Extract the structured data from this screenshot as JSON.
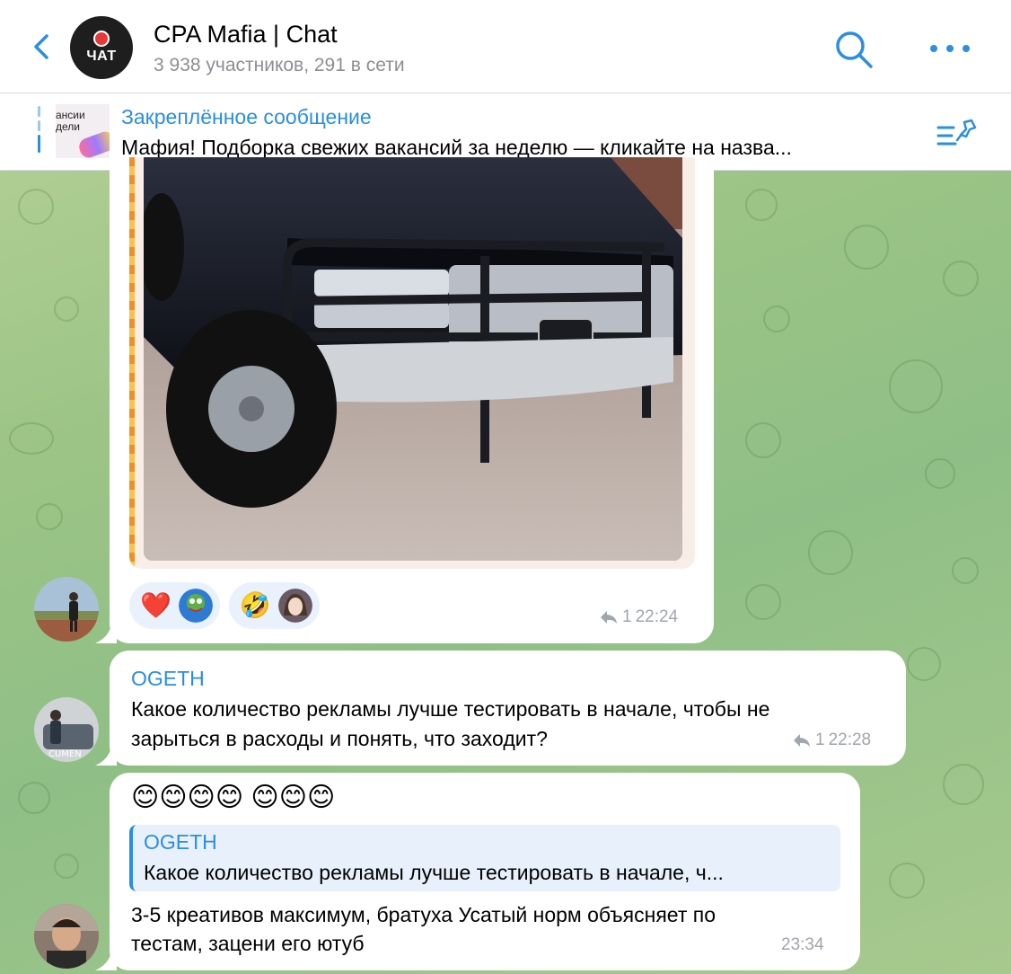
{
  "header": {
    "title": "CPA Mafia | Chat",
    "subtitle": "3 938 участников, 291 в сети",
    "avatar_text": "ЧАТ"
  },
  "pinned": {
    "label": "Закреплённое сообщение",
    "text": "Мафия! Подборка свежих вакансий за неделю — кликайте на назва...",
    "thumb_text": "ансии\nдели"
  },
  "messages": [
    {
      "type": "photo",
      "reactions": [
        {
          "emoji": "❤️"
        },
        {
          "emoji": "🤣"
        }
      ],
      "forwards": "1",
      "time": "22:24"
    },
    {
      "type": "text",
      "sender": "OGETH",
      "text_line1": "Какое количество рекламы лучше тестировать в начале, чтобы не",
      "text_line2": "зарыться в расходы и понять, что заходит?",
      "forwards": "1",
      "time": "22:28"
    },
    {
      "type": "reply",
      "emojis": "😊😊😊😊 😊😊😊",
      "quote_sender": "OGETH",
      "quote_text": "Какое количество рекламы лучше тестировать в начале, ч...",
      "text_line1": "3-5 креативов максимум, братуха Усатый норм объясняет по",
      "text_line2": "тестам, зацени его ютуб",
      "time": "23:34"
    }
  ],
  "colors": {
    "accent": "#2a8ee3",
    "bubble": "#ffffff",
    "meta": "#a0a6ad"
  }
}
